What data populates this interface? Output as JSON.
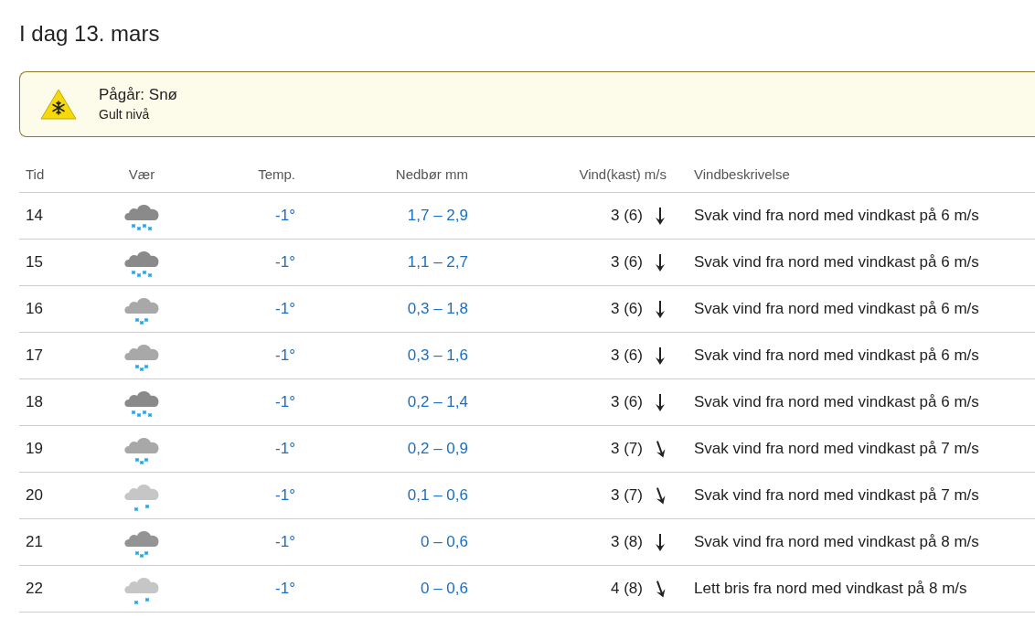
{
  "title": "I dag 13. mars",
  "warning": {
    "heading": "Pågår: Snø",
    "level_text": "Gult nivå"
  },
  "table": {
    "columns": [
      "Tid",
      "Vær",
      "Temp.",
      "Nedbør mm",
      "Vind(kast) m/s",
      "Vindbeskrivelse"
    ],
    "rows": [
      {
        "time": "14",
        "kind": "heavy",
        "temp": "-1°",
        "precip": "1,7 – 2,9",
        "wind": "3 (6)",
        "tilted": false,
        "description": "Svak vind fra nord med vindkast på 6 m/s"
      },
      {
        "time": "15",
        "kind": "heavy",
        "temp": "-1°",
        "precip": "1,1 – 2,7",
        "wind": "3 (6)",
        "tilted": false,
        "description": "Svak vind fra nord med vindkast på 6 m/s"
      },
      {
        "time": "16",
        "kind": "moderate",
        "temp": "-1°",
        "precip": "0,3 – 1,8",
        "wind": "3 (6)",
        "tilted": false,
        "description": "Svak vind fra nord med vindkast på 6 m/s"
      },
      {
        "time": "17",
        "kind": "moderate",
        "temp": "-1°",
        "precip": "0,3 – 1,6",
        "wind": "3 (6)",
        "tilted": false,
        "description": "Svak vind fra nord med vindkast på 6 m/s"
      },
      {
        "time": "18",
        "kind": "heavy",
        "temp": "-1°",
        "precip": "0,2 – 1,4",
        "wind": "3 (6)",
        "tilted": false,
        "description": "Svak vind fra nord med vindkast på 6 m/s"
      },
      {
        "time": "19",
        "kind": "moderate",
        "temp": "-1°",
        "precip": "0,2 – 0,9",
        "wind": "3 (7)",
        "tilted": true,
        "description": "Svak vind fra nord med vindkast på 7 m/s"
      },
      {
        "time": "20",
        "kind": "light",
        "temp": "-1°",
        "precip": "0,1 – 0,6",
        "wind": "3 (7)",
        "tilted": true,
        "description": "Svak vind fra nord med vindkast på 7 m/s"
      },
      {
        "time": "21",
        "kind": "moderate-dark",
        "temp": "-1°",
        "precip": "0 – 0,6",
        "wind": "3 (8)",
        "tilted": false,
        "description": "Svak vind fra nord med vindkast på 8 m/s"
      },
      {
        "time": "22",
        "kind": "light",
        "temp": "-1°",
        "precip": "0 – 0,6",
        "wind": "4 (8)",
        "tilted": true,
        "description": "Lett bris fra nord med vindkast på 8 m/s"
      }
    ]
  }
}
